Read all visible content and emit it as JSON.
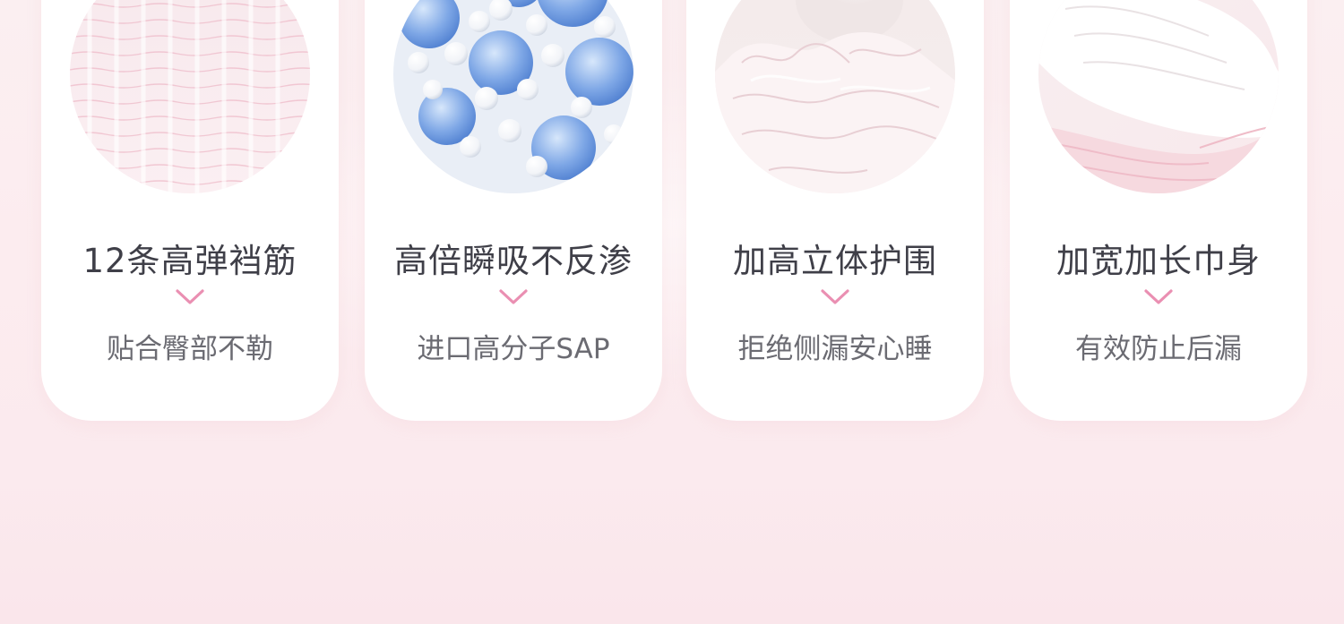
{
  "features": [
    {
      "title": "12条高弹裆筋",
      "subtitle": "贴合臀部不勒",
      "image_icon": "elastic-leg-cuffs-photo"
    },
    {
      "title": "高倍瞬吸不反渗",
      "subtitle": "进口高分子SAP",
      "image_icon": "sap-beads-photo"
    },
    {
      "title": "加高立体护围",
      "subtitle": "拒绝侧漏安心睡",
      "image_icon": "raised-side-guards-photo"
    },
    {
      "title": "加宽加长巾身",
      "subtitle": "有效防止后漏",
      "image_icon": "wide-long-pad-photo"
    }
  ],
  "colors": {
    "accent_chevron": "#ea8fb2",
    "title_text": "#3f3f48",
    "subtitle_text": "#6b6b72",
    "background": "#fcecef",
    "card": "#ffffff"
  }
}
